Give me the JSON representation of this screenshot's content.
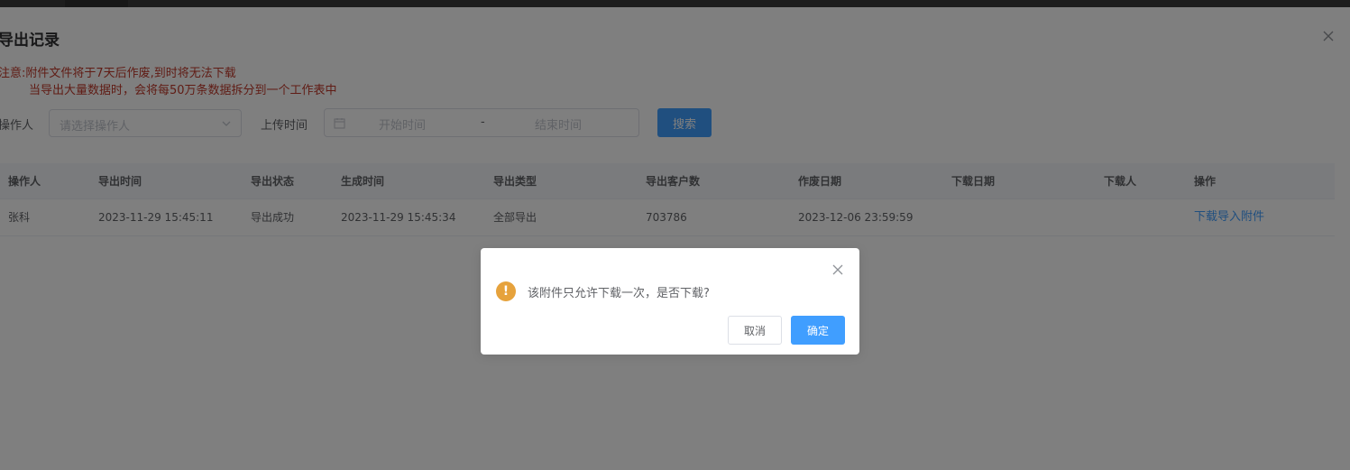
{
  "dialog": {
    "title": "导出记录",
    "notice_line1": "注意:附件文件将于7天后作废,到时将无法下载",
    "notice_line2": "当导出大量数据时，会将每50万条数据拆分到一个工作表中"
  },
  "filters": {
    "operator_label": "操作人",
    "operator_placeholder": "请选择操作人",
    "upload_time_label": "上传时间",
    "start_placeholder": "开始时间",
    "range_separator": "-",
    "end_placeholder": "结束时间",
    "search_label": "搜索"
  },
  "table": {
    "columns": [
      "操作人",
      "导出时间",
      "导出状态",
      "生成时间",
      "导出类型",
      "导出客户数",
      "作废日期",
      "下载日期",
      "下载人",
      "操作"
    ],
    "rows": [
      {
        "operator": "张科",
        "export_time": "2023-11-29 15:45:11",
        "status": "导出成功",
        "generated_time": "2023-11-29 15:45:34",
        "export_type": "全部导出",
        "customer_count": "703786",
        "expire_date": "2023-12-06 23:59:59",
        "download_date": "",
        "downloader": "",
        "action": "下载导入附件"
      }
    ]
  },
  "confirm": {
    "icon": "warning-icon",
    "icon_glyph": "!",
    "message": "该附件只允许下载一次，是否下载?",
    "cancel_label": "取消",
    "ok_label": "确定"
  },
  "colors": {
    "primary": "#409eff",
    "warning": "#e6a23c",
    "notice": "#c0392b"
  }
}
